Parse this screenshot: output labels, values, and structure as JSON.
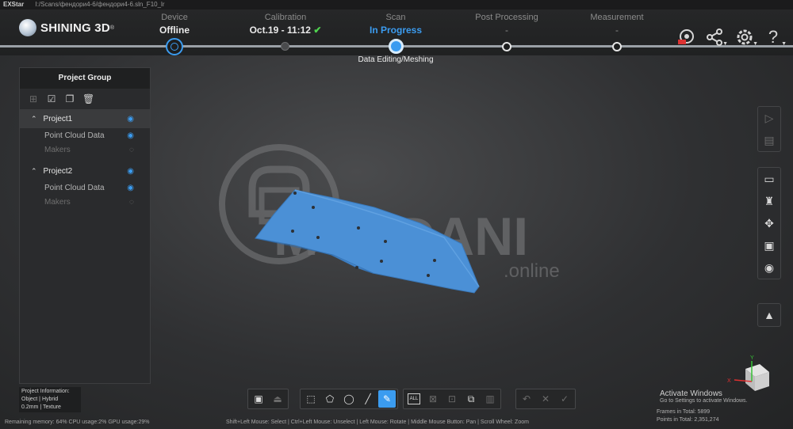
{
  "titlebar": {
    "app": "EXStar",
    "path": "I:/Scans/фендори4-6/фендори4-6.sln_F10_lr"
  },
  "brand": {
    "name": "SHINING 3D",
    "trademark": "®"
  },
  "steps": [
    {
      "label": "Device",
      "value": "Offline"
    },
    {
      "label": "Calibration",
      "value": "Oct.19 - 11:12",
      "check": "✔"
    },
    {
      "label": "Scan",
      "value": "In Progress"
    },
    {
      "label": "Post Processing",
      "value": "-"
    },
    {
      "label": "Measurement",
      "value": "-"
    }
  ],
  "sub_step": "Data Editing/Meshing",
  "header_icons": [
    "scanner-icon",
    "share-icon",
    "settings-icon",
    "help-icon"
  ],
  "project_panel": {
    "title": "Project Group",
    "projects": [
      {
        "name": "Project1",
        "items": [
          "Point Cloud Data",
          "Makers"
        ]
      },
      {
        "name": "Project2",
        "items": [
          "Point Cloud Data",
          "Makers"
        ]
      }
    ]
  },
  "project_info": {
    "title": "Project Information:",
    "line1": "Object | Hybrid",
    "line2": "0.2mm | Texture"
  },
  "watermark": {
    "name": "MOEDANI",
    "suffix": ".online"
  },
  "status": {
    "left": "Remaining memory: 64%  CPU usage:2%  GPU usage:29%",
    "hint": "Shift+Left Mouse: Select | Ctrl+Left Mouse: Unselect | Left Mouse: Rotate | Middle Mouse Button: Pan | Scroll Wheel: Zoom"
  },
  "activate": {
    "title": "Activate Windows",
    "sub": "Go to Settings to activate Windows."
  },
  "stats": {
    "frames": "Frames in Total: 5899",
    "points": "Points in Total: 2,351,274"
  },
  "bottom_toolbar": {
    "select_all": "ALL"
  },
  "axes": {
    "x": "X",
    "y": "Y"
  },
  "colors": {
    "accent": "#3b9cf0",
    "check": "#4fd34f",
    "mesh": "#4b90d6"
  }
}
